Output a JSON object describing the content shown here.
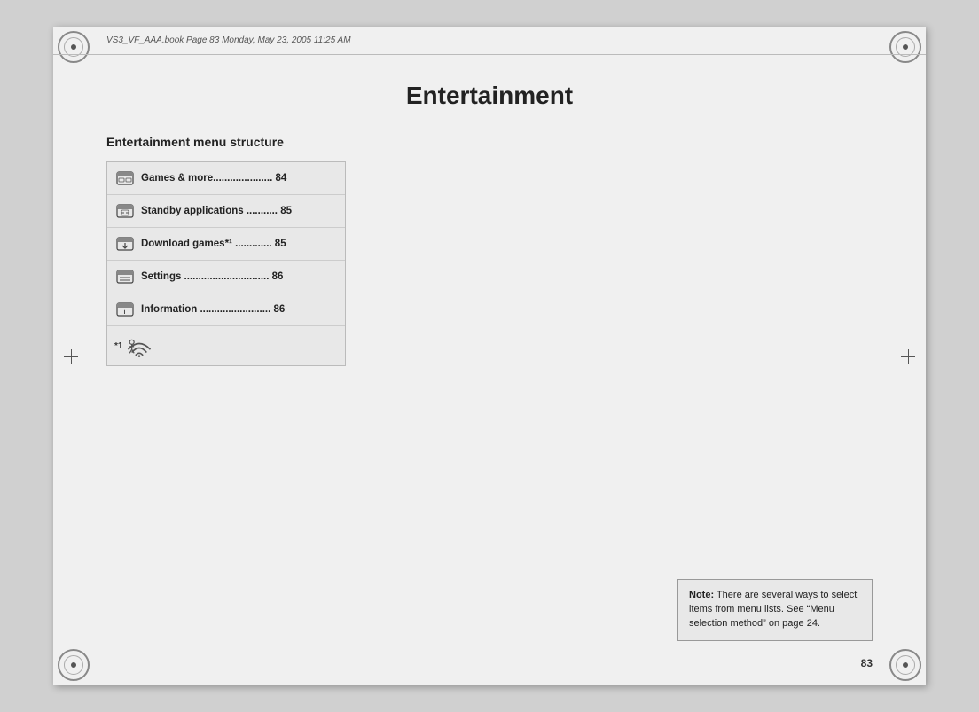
{
  "page": {
    "title": "Entertainment",
    "number": "83",
    "top_bar_text": "VS3_VF_AAA.book   Page 83   Monday, May 23, 2005   11:25 AM"
  },
  "section": {
    "heading": "Entertainment menu structure"
  },
  "menu_items": [
    {
      "id": 1,
      "text": "Games & more..................... 84",
      "icon": "games"
    },
    {
      "id": 2,
      "text": "Standby applications ........... 85",
      "icon": "standby"
    },
    {
      "id": 3,
      "text": "Download games*¹ ............. 85",
      "icon": "download"
    },
    {
      "id": 4,
      "text": "Settings .............................. 86",
      "icon": "settings"
    },
    {
      "id": 5,
      "text": "Information ......................... 86",
      "icon": "info"
    }
  ],
  "footnote": {
    "superscript": "*1",
    "icon_label": "wireless-symbol"
  },
  "note": {
    "label": "Note:",
    "text": " There are several ways to select items from menu lists. See “Menu selection method” on page 24."
  }
}
